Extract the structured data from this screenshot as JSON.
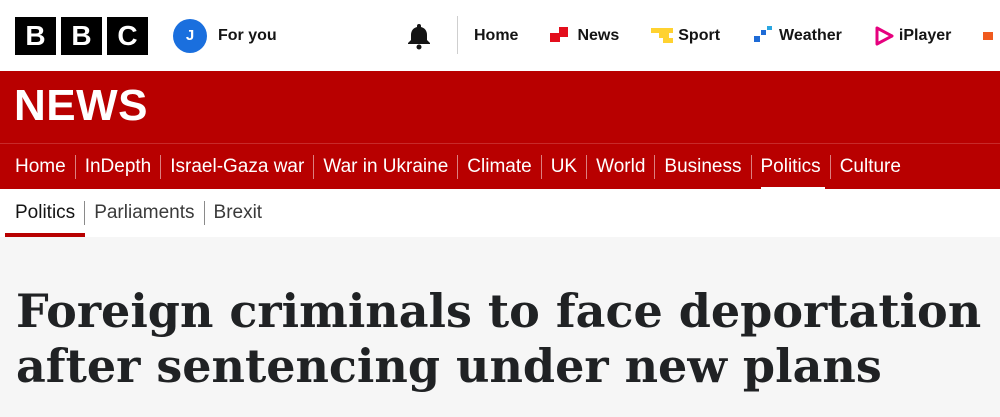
{
  "brand": {
    "letters": [
      "B",
      "B",
      "C"
    ]
  },
  "account": {
    "initial": "J",
    "label": "For you"
  },
  "colors": {
    "brand_red": "#b80000",
    "avatar_blue": "#1a6fde",
    "news_red": "#e30e1c",
    "sport_yellow": "#ffd230",
    "weather_blue": "#1e6bd6",
    "iplayer_pink": "#e6007e"
  },
  "topnav": {
    "items": [
      {
        "label": "Home",
        "icon": ""
      },
      {
        "label": "News",
        "icon": "news-icon"
      },
      {
        "label": "Sport",
        "icon": "sport-icon"
      },
      {
        "label": "Weather",
        "icon": "weather-icon"
      },
      {
        "label": "iPlayer",
        "icon": "iplayer-icon"
      }
    ]
  },
  "banner": {
    "title": "NEWS"
  },
  "section_nav": {
    "items": [
      "Home",
      "InDepth",
      "Israel-Gaza war",
      "War in Ukraine",
      "Climate",
      "UK",
      "World",
      "Business",
      "Politics",
      "Culture"
    ],
    "active": "Politics"
  },
  "sub_nav": {
    "items": [
      "Politics",
      "Parliaments",
      "Brexit"
    ],
    "active": "Politics"
  },
  "article": {
    "headline": "Foreign criminals to face deportation after sentencing under new plans"
  }
}
